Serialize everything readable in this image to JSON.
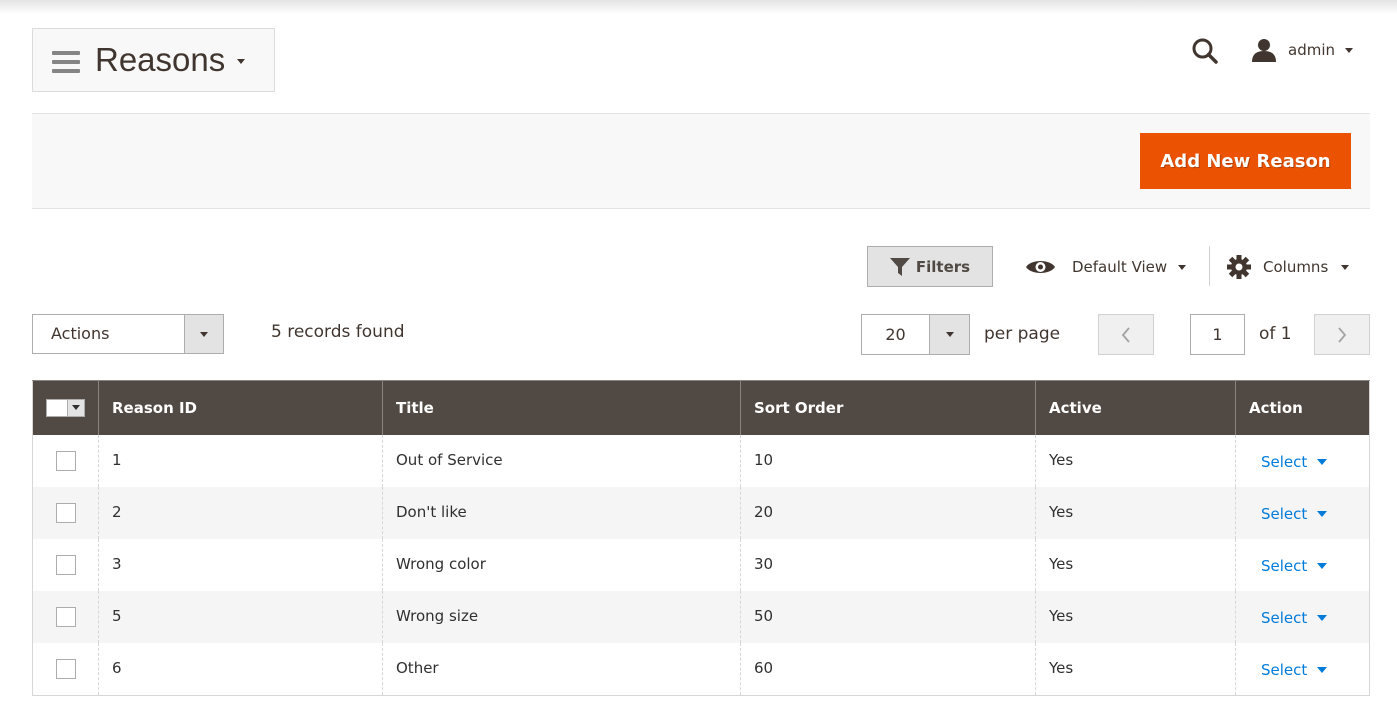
{
  "header": {
    "title": "Reasons",
    "user_name": "admin"
  },
  "action_bar": {
    "add_button_label": "Add New Reason"
  },
  "toolbar": {
    "filters_label": "Filters",
    "view_label": "Default View",
    "columns_label": "Columns"
  },
  "mass_actions": {
    "selected": "Actions"
  },
  "records_found": "5 records found",
  "pagination": {
    "per_page_value": "20",
    "per_page_label": "per page",
    "current_page": "1",
    "of_label": "of 1"
  },
  "grid": {
    "columns": [
      "Reason ID",
      "Title",
      "Sort Order",
      "Active",
      "Action"
    ],
    "rows": [
      {
        "id": "1",
        "title": "Out of Service",
        "sort_order": "10",
        "active": "Yes",
        "action": "Select"
      },
      {
        "id": "2",
        "title": "Don't like",
        "sort_order": "20",
        "active": "Yes",
        "action": "Select"
      },
      {
        "id": "3",
        "title": "Wrong color",
        "sort_order": "30",
        "active": "Yes",
        "action": "Select"
      },
      {
        "id": "5",
        "title": "Wrong size",
        "sort_order": "50",
        "active": "Yes",
        "action": "Select"
      },
      {
        "id": "6",
        "title": "Other",
        "sort_order": "60",
        "active": "Yes",
        "action": "Select"
      }
    ]
  },
  "colors": {
    "accent": "#eb5202",
    "header_bg": "#514943",
    "link": "#007bdb"
  }
}
